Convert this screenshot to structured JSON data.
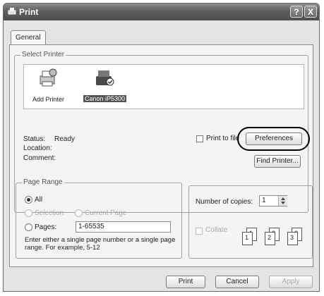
{
  "window": {
    "title": "Print",
    "help_btn": "?",
    "close_btn": "X"
  },
  "tabs": [
    {
      "label": "General"
    }
  ],
  "select_printer": {
    "group_label": "Select Printer",
    "printers": [
      {
        "label": "Add Printer"
      },
      {
        "label": "Canon iP5300",
        "selected": true
      }
    ]
  },
  "status": {
    "status_label": "Status:",
    "status_value": "Ready",
    "location_label": "Location:",
    "comment_label": "Comment:"
  },
  "print_to_file_label": "Print to file",
  "preferences_button": "Preferences",
  "find_printer_button": "Find Printer...",
  "page_range": {
    "group_label": "Page Range",
    "all_label": "All",
    "selection_label": "Selection",
    "current_page_label": "Current Page",
    "pages_label": "Pages:",
    "pages_value": "1-65535",
    "hint": "Enter either a single page number or a single page range.  For example, 5-12",
    "selected": "All"
  },
  "copies": {
    "label": "Number of copies:",
    "value": "1",
    "collate_label": "Collate",
    "page_numbers": [
      "1",
      "1",
      "2",
      "2",
      "3",
      "3"
    ]
  },
  "footer": {
    "print": "Print",
    "cancel": "Cancel",
    "apply": "Apply"
  },
  "colors": {
    "title_bar": "#5e5e5e",
    "window_bg": "#e4e4e4",
    "highlight_circle": "#000000"
  }
}
